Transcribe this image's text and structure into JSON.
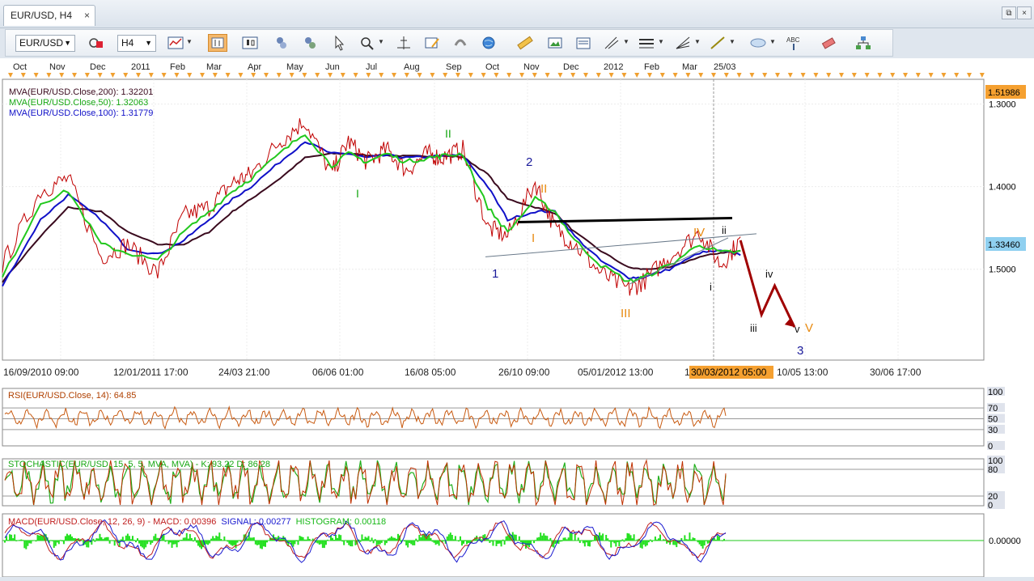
{
  "tab": {
    "title": "EUR/USD, H4",
    "close": "×"
  },
  "window": {
    "restore": "⧉",
    "close": "×"
  },
  "toolbar": {
    "symbol": "EUR/USD",
    "timeframe": "H4",
    "buttons": [
      "chart-type-icon",
      "bar-icon",
      "candle-icon",
      "line-icon",
      "indicators-icon",
      "overlay-icon",
      "crosshair-icon",
      "zoom-icon",
      "magnet-icon",
      "cursor-icon",
      "templates-icon",
      "globe-icon",
      "ruler-icon",
      "picture-icon",
      "news-icon",
      "pencil-icon",
      "hline-icon",
      "fan-icon",
      "trendline-icon",
      "ellipse-icon",
      "text-icon",
      "eraser-icon",
      "tree-icon"
    ]
  },
  "top_axis": {
    "labels": [
      "Oct",
      "Nov",
      "Dec",
      "2011",
      "Feb",
      "Mar",
      "Apr",
      "May",
      "Jun",
      "Jul",
      "Aug",
      "Sep",
      "Oct",
      "Nov",
      "Dec",
      "2012",
      "Feb",
      "Mar",
      "25/03"
    ]
  },
  "legend": {
    "ma200": "MVA(EUR/USD.Close,200): 1.32201",
    "ma50": "MVA(EUR/USD.Close,50): 1.32063",
    "ma100": "MVA(EUR/USD.Close,100): 1.31779"
  },
  "price_axis": {
    "ticks": [
      "1.5000",
      "1.4000",
      "1.3000"
    ],
    "high_label": "1.51986",
    "last_label": "1.33460"
  },
  "time_axis": {
    "labels": [
      "16/09/2010 09:00",
      "12/01/2011 17:00",
      "24/03 21:00",
      "06/06 01:00",
      "16/08 05:00",
      "26/10 09:00",
      "05/01/2012 13:00",
      "10/05 13:00",
      "30/06 17:00"
    ],
    "cursor_label": "30/03/2012 05:00",
    "cursor_prefix": "1"
  },
  "waves": {
    "green_I": "I",
    "green_II": "II",
    "blue_1": "1",
    "blue_2": "2",
    "blue_3": "3",
    "orange_I": "I",
    "orange_II": "II",
    "orange_III": "III",
    "orange_IV": "IV",
    "orange_V": "V",
    "small_i": "i",
    "small_ii": "ii",
    "small_iii": "iii",
    "small_iv": "iv",
    "small_v": "v"
  },
  "rsi": {
    "title": "RSI(EUR/USD.Close, 14): 64.85",
    "ticks": [
      "100",
      "70",
      "50",
      "30",
      "0"
    ]
  },
  "stoch": {
    "title": "STOCHASTIC(EUR/USD, 15, 5, 5, MVA, MVA) - K: 93.22  D: 86.28",
    "ticks": [
      "100",
      "80",
      "20",
      "0"
    ]
  },
  "macd": {
    "title_prefix": "MACD(EUR/USD.Close, 12, 26, 9) - MACD: 0.00396",
    "signal": "SIGNAL: 0.00277",
    "histogram": "HISTOGRAM: 0.00118",
    "ticks": [
      "0.00000"
    ]
  },
  "colors": {
    "ma200": "#3a0a1e",
    "ma50": "#22c81e",
    "ma100": "#1010c8",
    "price": "#c00000",
    "rsi": "#c85a10",
    "accent": "#f5a030",
    "projection": "#a00000"
  },
  "chart_data": {
    "type": "line",
    "title": "EUR/USD, H4",
    "x": [
      "2010-09-16",
      "2010-10-15",
      "2010-11-05",
      "2010-11-30",
      "2010-12-20",
      "2011-01-12",
      "2011-02-01",
      "2011-02-20",
      "2011-03-10",
      "2011-03-24",
      "2011-04-15",
      "2011-05-04",
      "2011-05-24",
      "2011-06-06",
      "2011-06-20",
      "2011-07-05",
      "2011-07-20",
      "2011-08-05",
      "2011-08-16",
      "2011-09-01",
      "2011-09-20",
      "2011-10-05",
      "2011-10-26",
      "2011-11-10",
      "2011-11-25",
      "2011-12-15",
      "2012-01-05",
      "2012-01-16",
      "2012-02-05",
      "2012-02-28",
      "2012-03-15",
      "2012-03-30"
    ],
    "series": [
      {
        "name": "EUR/USD.Close",
        "values": [
          1.305,
          1.395,
          1.41,
          1.315,
          1.33,
          1.295,
          1.365,
          1.375,
          1.405,
          1.415,
          1.455,
          1.48,
          1.415,
          1.455,
          1.43,
          1.445,
          1.42,
          1.44,
          1.435,
          1.445,
          1.35,
          1.34,
          1.405,
          1.35,
          1.33,
          1.295,
          1.275,
          1.285,
          1.315,
          1.345,
          1.305,
          1.335
        ]
      },
      {
        "name": "MVA(EUR/USD.Close,50)",
        "values": [
          1.29,
          1.38,
          1.395,
          1.33,
          1.32,
          1.31,
          1.345,
          1.37,
          1.395,
          1.41,
          1.44,
          1.465,
          1.425,
          1.44,
          1.43,
          1.44,
          1.43,
          1.435,
          1.437,
          1.44,
          1.375,
          1.345,
          1.385,
          1.37,
          1.335,
          1.305,
          1.285,
          1.29,
          1.305,
          1.33,
          1.32,
          1.321
        ]
      },
      {
        "name": "MVA(EUR/USD.Close,100)",
        "values": [
          1.28,
          1.36,
          1.39,
          1.36,
          1.325,
          1.318,
          1.335,
          1.36,
          1.385,
          1.4,
          1.43,
          1.455,
          1.44,
          1.44,
          1.435,
          1.438,
          1.435,
          1.436,
          1.437,
          1.438,
          1.4,
          1.36,
          1.37,
          1.37,
          1.34,
          1.31,
          1.29,
          1.29,
          1.3,
          1.32,
          1.322,
          1.318
        ]
      },
      {
        "name": "MVA(EUR/USD.Close,200)",
        "values": [
          1.285,
          1.34,
          1.375,
          1.37,
          1.345,
          1.33,
          1.33,
          1.345,
          1.37,
          1.385,
          1.41,
          1.435,
          1.44,
          1.44,
          1.438,
          1.438,
          1.437,
          1.437,
          1.437,
          1.436,
          1.415,
          1.385,
          1.375,
          1.368,
          1.345,
          1.322,
          1.302,
          1.3,
          1.302,
          1.315,
          1.32,
          1.322
        ]
      }
    ],
    "projection": {
      "x": [
        "2012-03-30",
        "2012-04-15",
        "2012-04-25",
        "2012-05-10"
      ],
      "values": [
        1.335,
        1.245,
        1.28,
        1.23
      ]
    },
    "ylim": [
      1.19,
      1.53
    ],
    "y_ticks": [
      1.3,
      1.4,
      1.5
    ],
    "grid": true,
    "legend_position": "top-left",
    "indicators": {
      "rsi": {
        "last": 64.85,
        "levels": [
          30,
          50,
          70
        ],
        "range": [
          0,
          100
        ]
      },
      "stochastic": {
        "K": 93.22,
        "D": 86.28,
        "levels": [
          20,
          80
        ],
        "range": [
          0,
          100
        ]
      },
      "macd": {
        "macd": 0.00396,
        "signal": 0.00277,
        "histogram": 0.00118
      }
    }
  }
}
